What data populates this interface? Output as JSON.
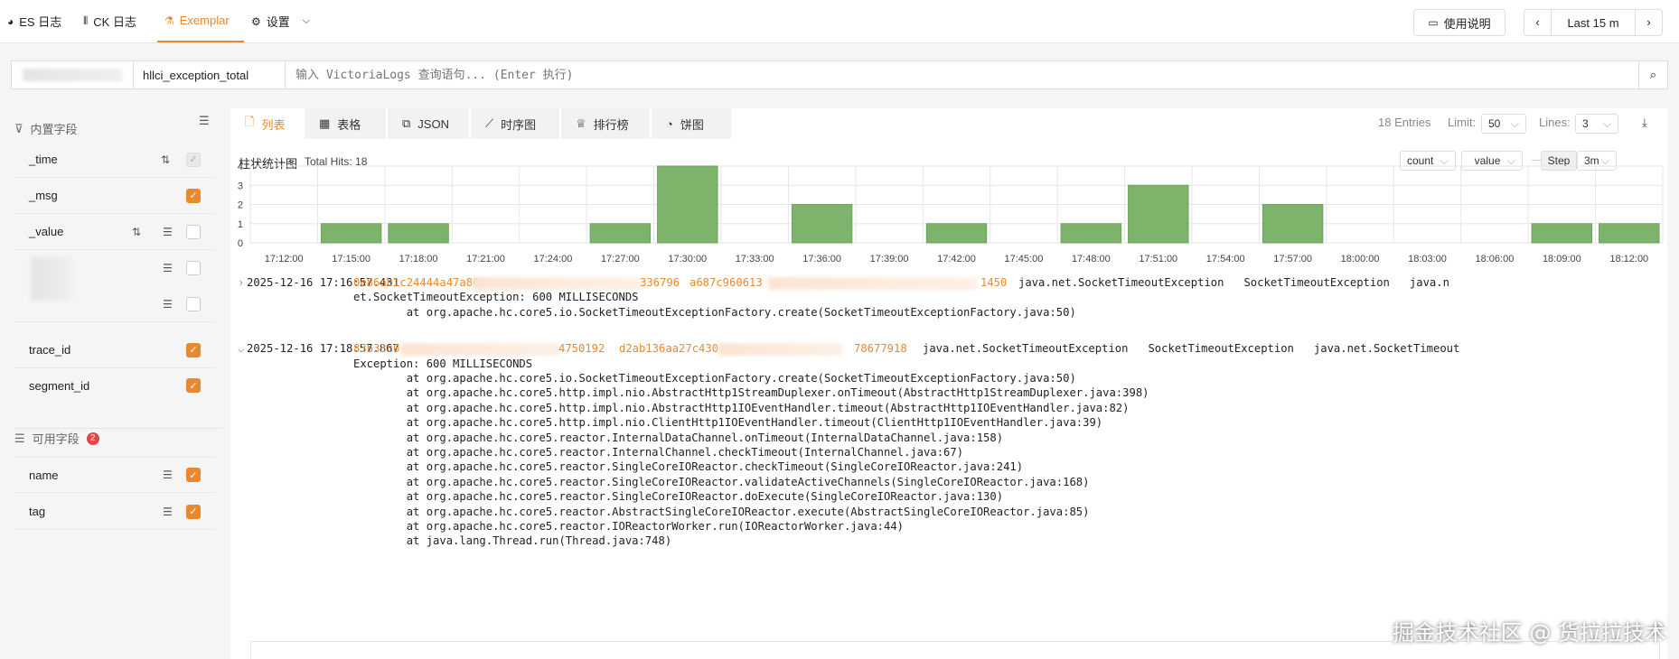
{
  "topbar": {
    "tabs": [
      {
        "label": "ES 日志",
        "icon": "elasticsearch-icon"
      },
      {
        "label": "CK 日志",
        "icon": "clickhouse-icon"
      },
      {
        "label": "Exemplar",
        "icon": "flask-icon"
      },
      {
        "label": "设置",
        "icon": "gear-icon"
      }
    ],
    "help_label": "使用说明",
    "time_range": "Last 15 m"
  },
  "query": {
    "metric": "hllci_exception_total",
    "placeholder": "输入 VictoriaLogs 查询语句... (Enter 执行)"
  },
  "sidebar": {
    "builtin_title": "内置字段",
    "builtin_fields": [
      {
        "name": "_time",
        "checked": true,
        "disabled": true
      },
      {
        "name": "_msg",
        "checked": true
      },
      {
        "name": "_value",
        "checked": false
      },
      {
        "name": "",
        "checked": false
      },
      {
        "name": "",
        "checked": false
      },
      {
        "name": "trace_id",
        "checked": true
      },
      {
        "name": "segment_id",
        "checked": true
      }
    ],
    "available_title": "可用字段",
    "available_count": "2",
    "available_fields": [
      {
        "name": "name",
        "checked": true
      },
      {
        "name": "tag",
        "checked": true
      }
    ]
  },
  "views": {
    "tabs": [
      "列表",
      "表格",
      "JSON",
      "时序图",
      "排行榜",
      "饼图"
    ],
    "entries": "18 Entries",
    "limit_label": "Limit:",
    "limit_value": "50",
    "lines_label": "Lines:",
    "lines_value": "3"
  },
  "histogram": {
    "title": "柱状统计图",
    "total_hits": "Total Hits: 18",
    "agg": "count",
    "field": "_value",
    "step_label": "Step",
    "step_value": "3m"
  },
  "chart_data": {
    "type": "bar",
    "categories": [
      "17:12:00",
      "17:15:00",
      "17:18:00",
      "17:21:00",
      "17:24:00",
      "17:27:00",
      "17:30:00",
      "17:33:00",
      "17:36:00",
      "17:39:00",
      "17:42:00",
      "17:45:00",
      "17:48:00",
      "17:51:00",
      "17:54:00",
      "17:57:00",
      "18:00:00",
      "18:03:00",
      "18:06:00",
      "18:09:00",
      "18:12:00"
    ],
    "values": [
      0,
      1,
      1,
      0,
      0,
      1,
      4,
      0,
      2,
      0,
      1,
      0,
      1,
      3,
      0,
      2,
      0,
      0,
      0,
      1,
      1
    ],
    "ylim": [
      0,
      4
    ],
    "yticks": [
      0,
      1,
      2,
      3,
      4
    ],
    "color": "#7db36b",
    "grid": true
  },
  "logs": [
    {
      "time": "2025-12-16 17:16:57.431",
      "expanded": false,
      "trace_start": "0e86ab1c24444a47a80c",
      "trace_end": "336796",
      "segment_start": "a687c960613",
      "segment_end": "1450",
      "fields": "java.net.SocketTimeoutException   SocketTimeoutException   java.n",
      "lines": [
        "et.SocketTimeoutException: 600 MILLISECONDS",
        "        at org.apache.hc.core5.io.SocketTimeoutExceptionFactory.create(SocketTimeoutExceptionFactory.java:50)"
      ]
    },
    {
      "time": "2025-12-16 17:18:57.867",
      "expanded": true,
      "trace_start": "83b33c0",
      "trace_end": "4750192",
      "segment_start": "d2ab136aa27c430",
      "segment_end": "78677918",
      "fields": "java.net.SocketTimeoutException   SocketTimeoutException   java.net.SocketTimeout",
      "lines": [
        "Exception: 600 MILLISECONDS",
        "        at org.apache.hc.core5.io.SocketTimeoutExceptionFactory.create(SocketTimeoutExceptionFactory.java:50)",
        "        at org.apache.hc.core5.http.impl.nio.AbstractHttp1StreamDuplexer.onTimeout(AbstractHttp1StreamDuplexer.java:398)",
        "        at org.apache.hc.core5.http.impl.nio.AbstractHttp1IOEventHandler.timeout(AbstractHttp1IOEventHandler.java:82)",
        "        at org.apache.hc.core5.http.impl.nio.ClientHttp1IOEventHandler.timeout(ClientHttp1IOEventHandler.java:39)",
        "        at org.apache.hc.core5.reactor.InternalDataChannel.onTimeout(InternalDataChannel.java:158)",
        "        at org.apache.hc.core5.reactor.InternalChannel.checkTimeout(InternalChannel.java:67)",
        "        at org.apache.hc.core5.reactor.SingleCoreIOReactor.checkTimeout(SingleCoreIOReactor.java:241)",
        "        at org.apache.hc.core5.reactor.SingleCoreIOReactor.validateActiveChannels(SingleCoreIOReactor.java:168)",
        "        at org.apache.hc.core5.reactor.SingleCoreIOReactor.doExecute(SingleCoreIOReactor.java:130)",
        "        at org.apache.hc.core5.reactor.AbstractSingleCoreIOReactor.execute(AbstractSingleCoreIOReactor.java:85)",
        "        at org.apache.hc.core5.reactor.IOReactorWorker.run(IOReactorWorker.java:44)",
        "        at java.lang.Thread.run(Thread.java:748)"
      ]
    }
  ],
  "watermark": "掘金技术社区 @ 货拉拉技术"
}
